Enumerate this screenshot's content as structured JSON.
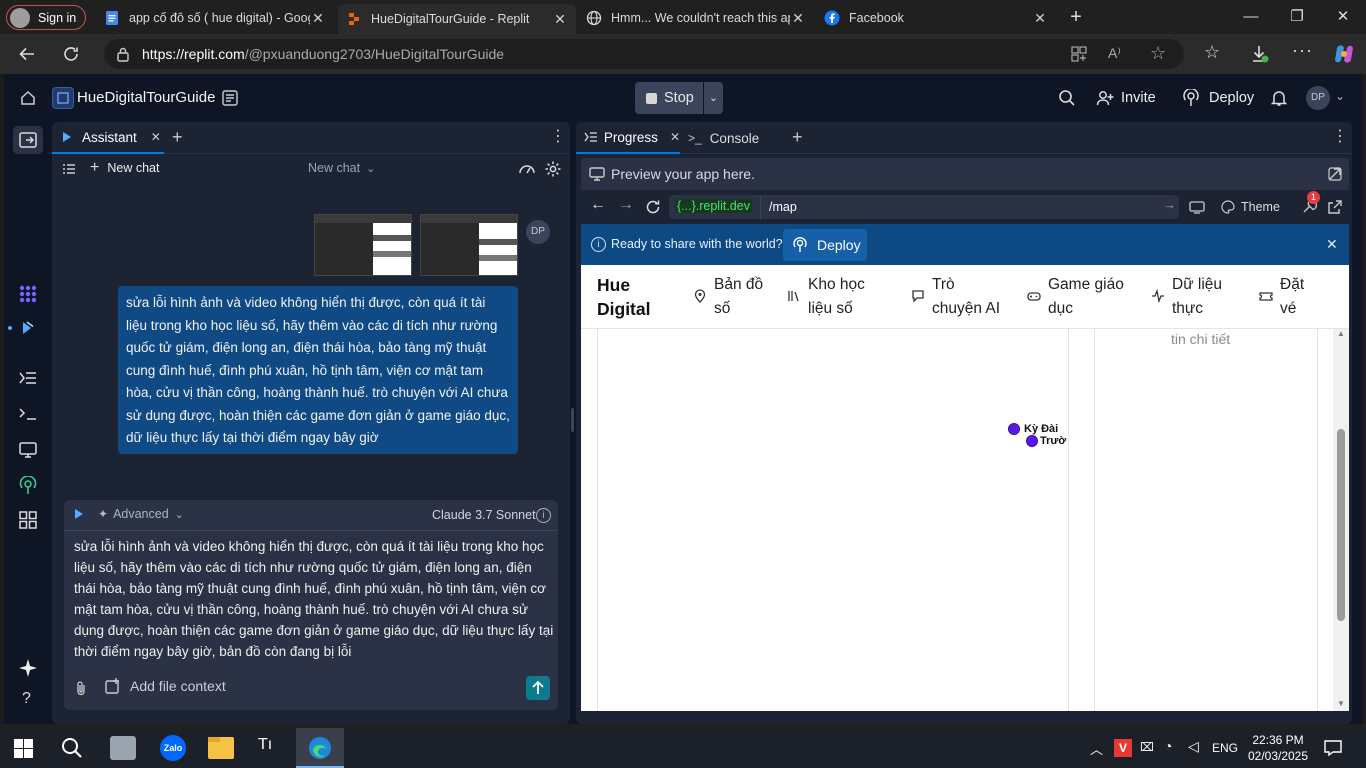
{
  "browser": {
    "signin_label": "Sign in",
    "tabs": [
      {
        "label": "app cố đô số ( hue digital) - Goog",
        "icon": "docs-icon"
      },
      {
        "label": "HueDigitalTourGuide - Replit",
        "icon": "replit-icon",
        "active": true
      },
      {
        "label": "Hmm... We couldn't reach this app",
        "icon": "globe-icon"
      },
      {
        "label": "Facebook",
        "icon": "facebook-icon"
      }
    ],
    "url_host": "https://replit.com",
    "url_path": "/@pxuanduong2703/HueDigitalTourGuide"
  },
  "replit": {
    "repl_name": "HueDigitalTourGuide",
    "stop_label": "Stop",
    "invite_label": "Invite",
    "deploy_label": "Deploy",
    "avatar_initials": "DP"
  },
  "assistant": {
    "tab_label": "Assistant",
    "new_chat_label": "New chat",
    "chat_selector": "New chat",
    "user_initials": "DP",
    "user_message": "sửa lỗi hình ảnh và video không hiển thị được, còn quá ít tài liệu trong kho học liệu số, hãy thêm vào các di tích như rường quốc tử giám, điện long an, điện thái hòa, bảo tàng mỹ thuật cung đình huế, đình phú xuân, hồ tịnh tâm, viện cơ mật tam hòa, cửu vị thần công, hoàng thành huế. trò chuyện với AI chưa sử dụng được, hoàn thiện các game đơn giản ở game giáo dục, dữ liệu thực lấy tại thời điểm ngay bây giờ",
    "mode_label": "Advanced",
    "model_label": "Claude 3.7 Sonnet",
    "composer_text": "sửa lỗi hình ảnh và video không hiển thị được, còn quá ít tài liệu trong kho học liệu số, hãy thêm vào các di tích như rường quốc tử giám, điện long an, điện thái hòa, bảo tàng mỹ thuật cung đình huế, đình phú xuân, hồ tịnh tâm, viện cơ mật tam hòa, cửu vị thần công, hoàng thành huế. trò chuyện với AI chưa sử dụng được, hoàn thiện các game đơn giản ở game giáo dục, dữ liệu thực lấy tại thời điểm ngay bây giờ, bản đồ còn đang bị lỗi",
    "add_context_label": "Add file context"
  },
  "right_tabs": {
    "progress_label": "Progress",
    "console_label": "Console"
  },
  "preview": {
    "header_label": "Preview your app here.",
    "domain_label": "{...}.replit.dev",
    "path_label": "/map",
    "theme_label": "Theme",
    "badge_count": "1",
    "banner_text": "Ready to share with the world?",
    "banner_deploy": "Deploy"
  },
  "site": {
    "logo_line1": "Hue",
    "logo_line2": "Digital",
    "nav": [
      {
        "line1": "Bản đồ",
        "line2": "số"
      },
      {
        "line1": "Kho học",
        "line2": "liệu số"
      },
      {
        "line1": "Trò",
        "line2": "chuyện AI"
      },
      {
        "line1": "Game giáo",
        "line2": "dục"
      },
      {
        "line1": "Dữ liệu",
        "line2": "thực"
      },
      {
        "line1": "Đặt",
        "line2": "vé"
      }
    ],
    "side_text": "tin chi tiết",
    "marker1": "Kỳ Đài",
    "marker2": "Trườ"
  },
  "taskbar": {
    "lang": "ENG",
    "time": "22:36 PM",
    "date": "02/03/2025"
  }
}
